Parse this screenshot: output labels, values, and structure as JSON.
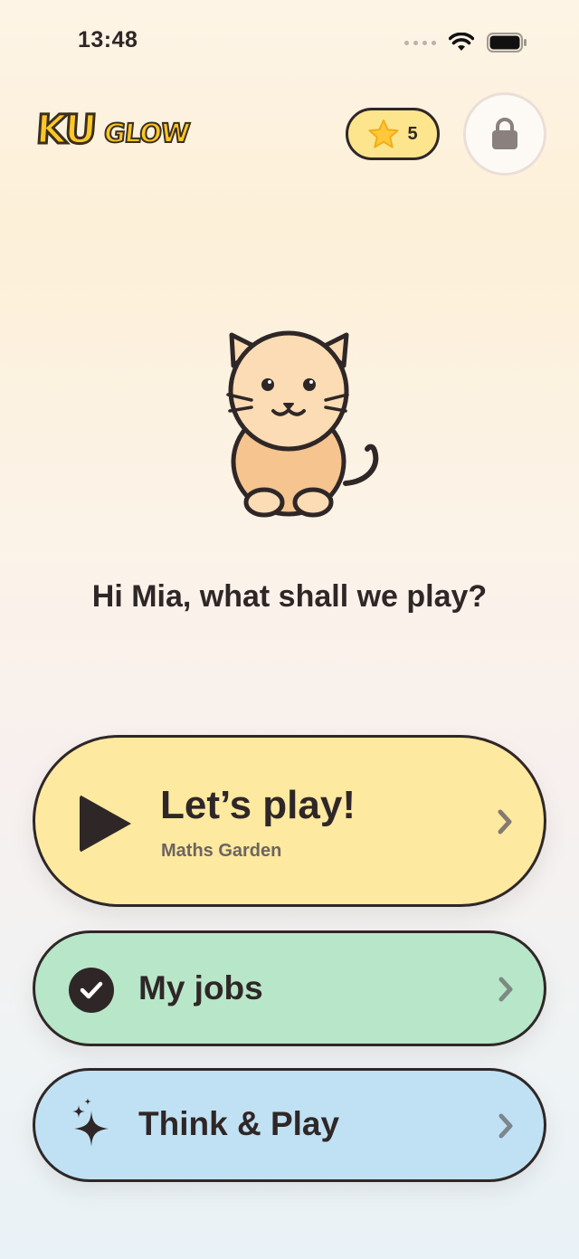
{
  "status_bar": {
    "time": "13:48",
    "icons": [
      "cellular-dots-icon",
      "wifi-icon",
      "battery-icon"
    ]
  },
  "header": {
    "logo_primary": "KU",
    "logo_secondary": "GLOW",
    "star_count": "5",
    "star_icon": "star-icon",
    "lock_icon": "lock-icon"
  },
  "mascot": {
    "icon": "cat-icon"
  },
  "greeting": "Hi Mia, what shall we play?",
  "menu": {
    "play": {
      "title": "Let’s play!",
      "subtitle": "Maths Garden",
      "icon": "play-icon",
      "color": "#fde9a0"
    },
    "jobs": {
      "label": "My jobs",
      "icon": "check-circle-icon",
      "color": "#b8e6c8"
    },
    "think": {
      "label": "Think & Play",
      "icon": "sparkle-icon",
      "color": "#c0e1f3"
    }
  },
  "colors": {
    "outline": "#2f2727",
    "star_pill": "#fde58e",
    "logo_yellow": "#ffc627",
    "cat_fur": "#f8cf9c"
  }
}
